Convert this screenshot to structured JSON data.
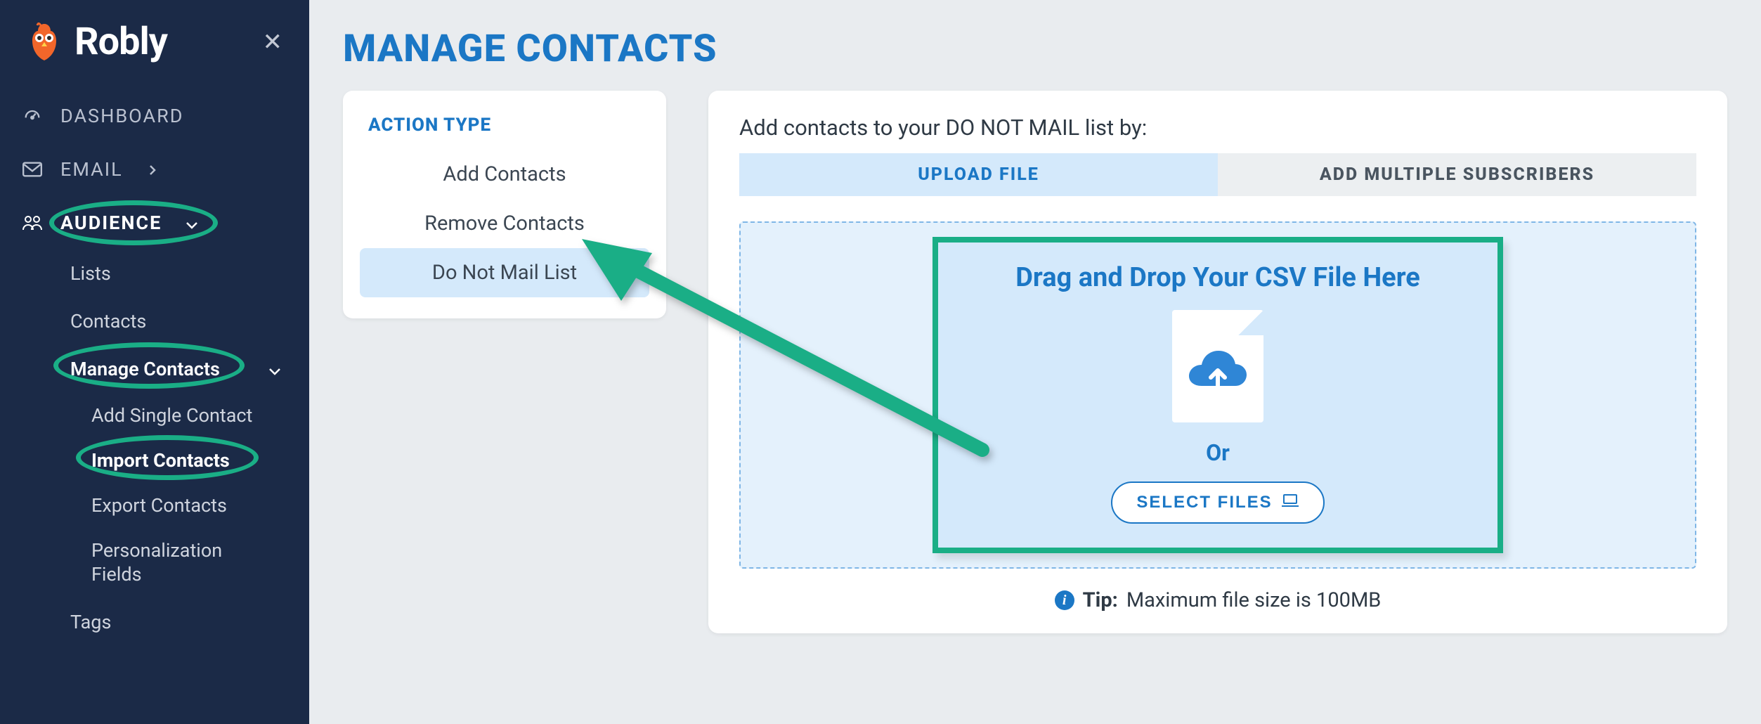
{
  "brand": "Robly",
  "sidebar": {
    "dashboard": "DASHBOARD",
    "email": "EMAIL",
    "audience": "AUDIENCE",
    "sub": {
      "lists": "Lists",
      "contacts": "Contacts",
      "manage_contacts": "Manage Contacts",
      "add_single": "Add Single Contact",
      "import": "Import Contacts",
      "export": "Export Contacts",
      "personalization": "Personalization Fields",
      "tags": "Tags"
    }
  },
  "page": {
    "title": "MANAGE CONTACTS"
  },
  "action_panel": {
    "heading": "ACTION TYPE",
    "items": {
      "add": "Add Contacts",
      "remove": "Remove Contacts",
      "dnm": "Do Not Mail List"
    }
  },
  "upload": {
    "instruction": "Add contacts to your DO NOT MAIL list by:",
    "tabs": {
      "upload_file": "UPLOAD FILE",
      "add_multiple": "ADD MULTIPLE SUBSCRIBERS"
    },
    "drop_title": "Drag and Drop Your CSV File Here",
    "or": "Or",
    "select_files": "SELECT FILES",
    "tip_label": "Tip:",
    "tip_text": "Maximum file size is 100MB"
  }
}
